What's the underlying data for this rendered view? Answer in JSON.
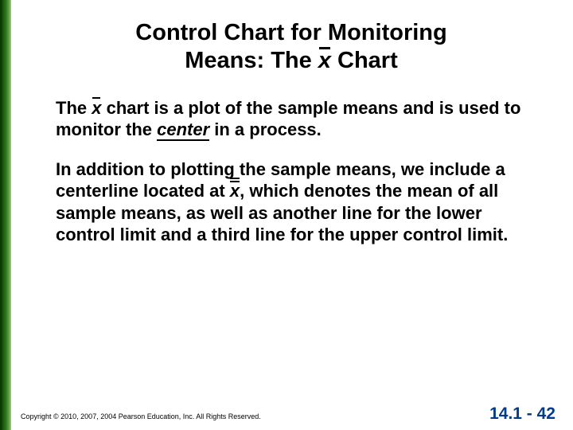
{
  "title_line1": "Control Chart for Monitoring",
  "title_line2_a": "Means:  The ",
  "title_line2_b": " Chart",
  "xbar_sym": "x",
  "xdbar_sym": "x",
  "para1_a": "The ",
  "para1_b": " chart is a plot of the sample means and is used to monitor the ",
  "para1_center": "center",
  "para1_c": " in a process.",
  "para2_a": "In addition to plotting the sample means, we include a centerline located at ",
  "para2_b": ", which denotes the mean of all sample means, as well as another line for the lower control limit and a third line for the upper control limit.",
  "copyright": "Copyright © 2010, 2007, 2004 Pearson Education, Inc. All Rights Reserved.",
  "pagenum": "14.1 - 42"
}
